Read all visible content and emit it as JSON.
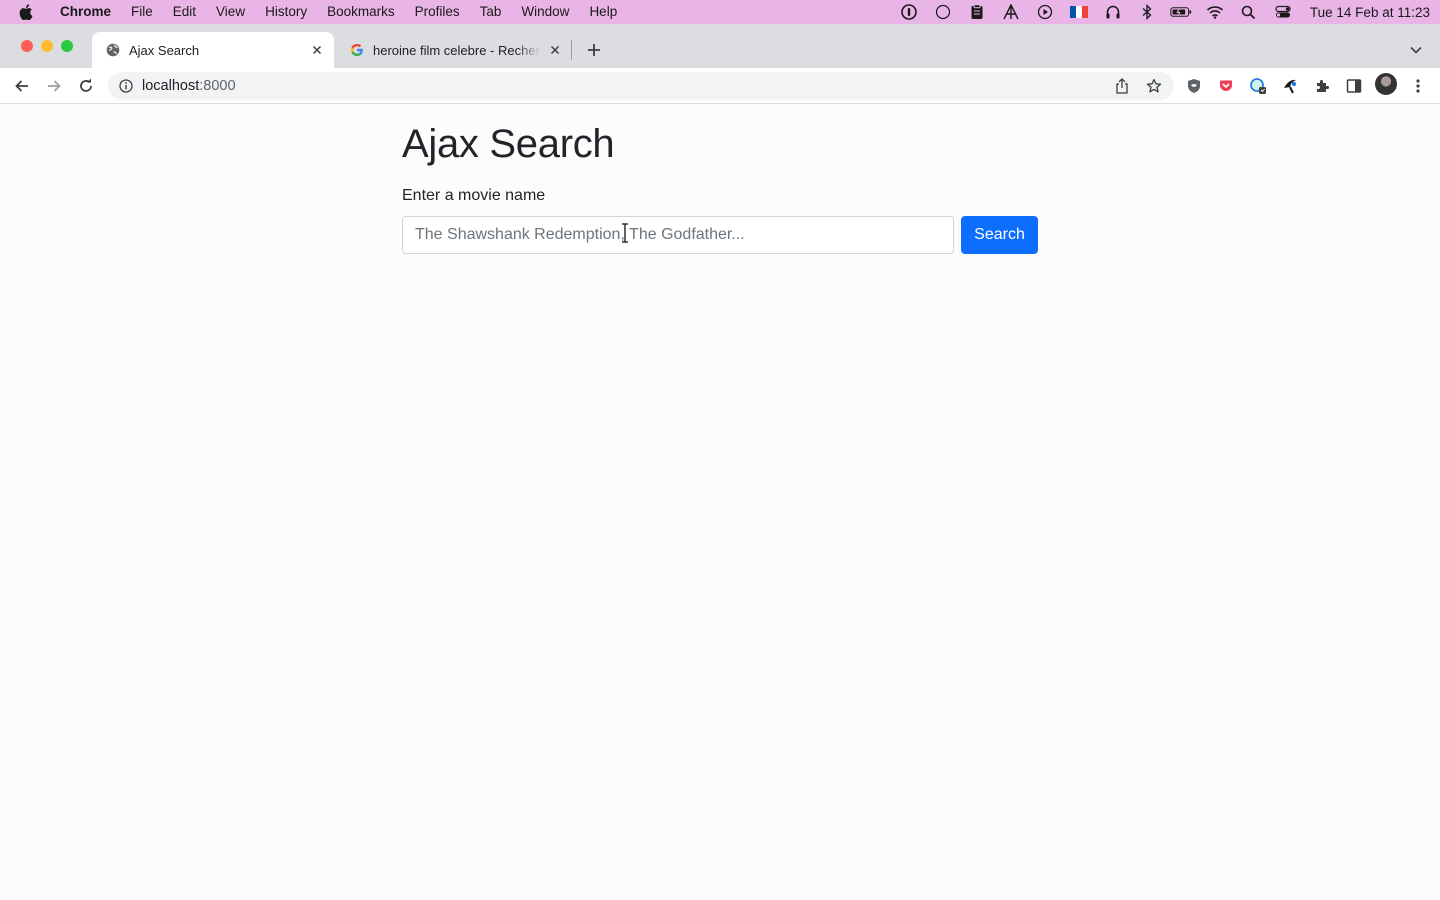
{
  "menubar": {
    "app_name": "Chrome",
    "items": [
      "File",
      "Edit",
      "View",
      "History",
      "Bookmarks",
      "Profiles",
      "Tab",
      "Window",
      "Help"
    ],
    "clock": "Tue 14 Feb at  11:23",
    "status_icons": [
      "1password-icon",
      "circle-icon",
      "clipboard-icon",
      "adobe-icon",
      "play-icon",
      "french-flag-icon",
      "headphones-icon",
      "bluetooth-icon",
      "battery-icon",
      "wifi-icon",
      "spotlight-search-icon",
      "control-center-icon"
    ]
  },
  "tabs": [
    {
      "title": "Ajax Search",
      "icon": "globe-icon",
      "active": true
    },
    {
      "title": "heroine film celebre - Recherche Google",
      "icon": "google-icon",
      "active": false
    }
  ],
  "toolbar": {
    "url_host": "localhost",
    "url_port": ":8000",
    "extension_icons": [
      "share-icon",
      "bookmark-star-icon",
      "privacy-badger-icon",
      "pocket-icon",
      "grammarly-icon",
      "raindrop-icon",
      "extensions-puzzle-icon",
      "side-panel-icon",
      "profile-avatar",
      "kebab-menu-icon"
    ]
  },
  "page": {
    "title": "Ajax Search",
    "label": "Enter a movie name",
    "search_placeholder": "The Shawshank Redemption, The Godfather...",
    "search_value": "",
    "search_button": "Search"
  },
  "colors": {
    "primary": "#0d6efd",
    "menubar_bg": "#e9b4e6",
    "tabstrip_bg": "#dcdde0"
  }
}
